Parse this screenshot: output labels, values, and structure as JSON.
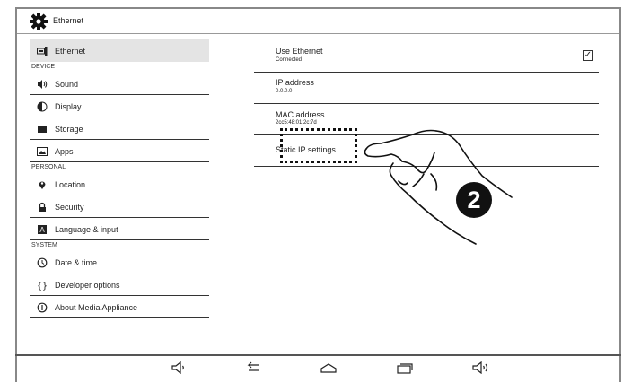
{
  "window": {
    "title": "Ethernet"
  },
  "sidebar": {
    "top_item": {
      "label": "Ethernet",
      "icon": "ethernet-icon"
    },
    "sections": [
      {
        "header": "DEVICE",
        "items": [
          {
            "label": "Sound",
            "icon": "sound-icon"
          },
          {
            "label": "Display",
            "icon": "display-icon"
          },
          {
            "label": "Storage",
            "icon": "storage-icon"
          },
          {
            "label": "Apps",
            "icon": "apps-icon"
          }
        ]
      },
      {
        "header": "PERSONAL",
        "items": [
          {
            "label": "Location",
            "icon": "location-icon"
          },
          {
            "label": "Security",
            "icon": "lock-icon"
          },
          {
            "label": "Language & input",
            "icon": "language-icon"
          }
        ]
      },
      {
        "header": "SYSTEM",
        "items": [
          {
            "label": "Date & time",
            "icon": "clock-icon"
          },
          {
            "label": "Developer options",
            "icon": "braces-icon"
          },
          {
            "label": "About Media Appliance",
            "icon": "info-icon"
          }
        ]
      }
    ]
  },
  "settings": {
    "use_ethernet": {
      "title": "Use Ethernet",
      "summary": "Connected",
      "checked": true
    },
    "ip_address": {
      "title": "IP address",
      "summary": "0.0.0.0"
    },
    "mac_address": {
      "title": "MAC address",
      "summary": "2cc5:48:01:2c:7d"
    },
    "static_ip": {
      "title": "Static IP settings"
    }
  },
  "annotation": {
    "step": "2"
  },
  "navbar": {
    "icons": [
      "volume-down-icon",
      "back-icon",
      "home-icon",
      "recents-icon",
      "volume-up-icon"
    ]
  }
}
